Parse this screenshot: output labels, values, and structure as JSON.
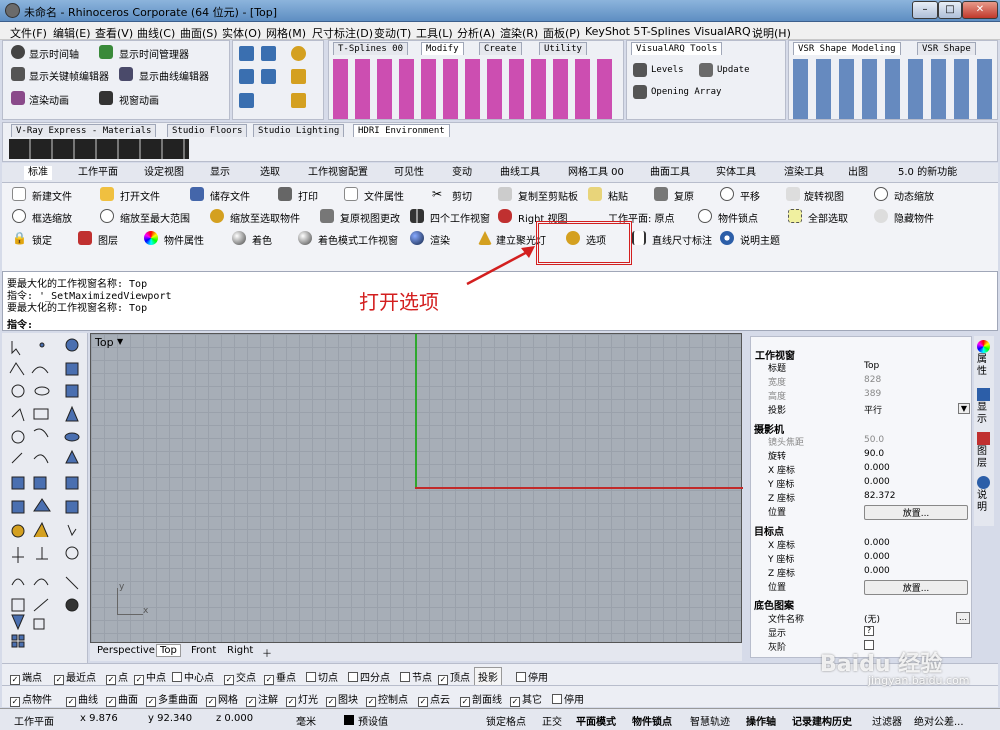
{
  "window": {
    "title": "未命名 - Rhinoceros Corporate (64 位元) - [Top]"
  },
  "menu": [
    "文件(F)",
    "编辑(E)",
    "查看(V)",
    "曲线(C)",
    "曲面(S)",
    "实体(O)",
    "网格(M)",
    "尺寸标注(D)",
    "变动(T)",
    "工具(L)",
    "分析(A)",
    "渲染(R)",
    "面板(P)",
    "KeyShot 5",
    "T-Splines",
    "VisualARQ",
    "说明(H)"
  ],
  "anim": {
    "items": [
      "显示时间轴",
      "显示时间管理器",
      "显示关键帧编辑器",
      "显示曲线编辑器",
      "渲染动画",
      "视窗动画"
    ]
  },
  "plugin_tabs1": [
    "T-Splines 00",
    "Modify",
    "Create",
    "Utility"
  ],
  "varq": {
    "tab": "VisualARQ Tools",
    "levels": "Levels",
    "update": "Update",
    "opening": "Opening Array"
  },
  "vsr": {
    "tab1": "VSR Shape Modeling",
    "tab2": "VSR Shape"
  },
  "mat_tabs": [
    "V-Ray Express - Materials",
    "Studio Floors",
    "Studio Lighting",
    "HDRI Environment"
  ],
  "std_tabs": [
    "标准",
    "工作平面",
    "设定视图",
    "显示",
    "选取",
    "工作视窗配置",
    "可见性",
    "变动",
    "曲线工具",
    "网格工具 00",
    "曲面工具",
    "实体工具",
    "渲染工具",
    "出图",
    "5.0 的新功能"
  ],
  "cmds": {
    "row1": [
      "新建文件",
      "打开文件",
      "储存文件",
      "打印",
      "文件属性",
      "剪切",
      "复制至剪贴板",
      "粘贴",
      "复原",
      "平移",
      "旋转视图",
      "动态缩放"
    ],
    "row2": [
      "框选缩放",
      "缩放至最大范围",
      "缩放至选取物件",
      "复原视图更改",
      "四个工作视窗",
      "Right 视图",
      "工作平面: 原点",
      "物件锁点",
      "全部选取",
      "隐藏物件"
    ],
    "row3": [
      "锁定",
      "图层",
      "物件属性",
      "着色",
      "着色模式工作视窗",
      "渲染",
      "建立聚光灯",
      "选项",
      "直线尺寸标注",
      "说明主题"
    ]
  },
  "history": [
    "要最大化的工作视窗名称: Top",
    "指令: '_SetMaximizedViewport",
    "要最大化的工作视窗名称: Top"
  ],
  "prompt": "指令:",
  "annotation": "打开选项",
  "viewport": {
    "name": "Top",
    "tabs": [
      "Perspective",
      "Top",
      "Front",
      "Right"
    ],
    "axis_x": "x",
    "axis_y": "y"
  },
  "props": {
    "title": "工作视窗",
    "rows1": [
      [
        "标题",
        "Top"
      ],
      [
        "宽度",
        "828"
      ],
      [
        "高度",
        "389"
      ],
      [
        "投影",
        "平行"
      ]
    ],
    "cam_title": "摄影机",
    "rows2": [
      [
        "镜头焦距",
        "50.0"
      ],
      [
        "旋转",
        "90.0"
      ],
      [
        "X 座标",
        "0.000"
      ],
      [
        "Y 座标",
        "0.000"
      ],
      [
        "Z 座标",
        "82.372"
      ],
      [
        "位置",
        "放置..."
      ]
    ],
    "tgt_title": "目标点",
    "rows3": [
      [
        "X 座标",
        "0.000"
      ],
      [
        "Y 座标",
        "0.000"
      ],
      [
        "Z 座标",
        "0.000"
      ],
      [
        "位置",
        "放置..."
      ]
    ],
    "bg_title": "底色图案",
    "rows4": [
      [
        "文件名称",
        "(无)"
      ],
      [
        "显示",
        ""
      ],
      [
        "灰阶",
        ""
      ]
    ],
    "side_tabs": [
      "属性",
      "显示",
      "图层",
      "说明"
    ]
  },
  "osnap": [
    "端点",
    "最近点",
    "点",
    "中点",
    "中心点",
    "交点",
    "垂点",
    "切点",
    "四分点",
    "节点",
    "顶点",
    "投影",
    "停用"
  ],
  "osnap_checked": [
    true,
    true,
    true,
    true,
    false,
    true,
    true,
    false,
    false,
    false,
    true,
    false,
    false
  ],
  "filter": [
    "点物件",
    "曲线",
    "曲面",
    "多重曲面",
    "网格",
    "注解",
    "灯光",
    "图块",
    "控制点",
    "点云",
    "剖面线",
    "其它",
    "停用"
  ],
  "status": {
    "plane": "工作平面",
    "x": "x 9.876",
    "y": "y 92.340",
    "z": "z 0.000",
    "unit": "毫米",
    "layer": "预设值",
    "items": [
      "锁定格点",
      "正交",
      "平面模式",
      "物件锁点",
      "智慧轨迹",
      "操作轴",
      "记录建构历史",
      "过滤器",
      "绝对公差..."
    ]
  },
  "watermark": "Baidu 经验",
  "watermark_url": "jingyan.baidu.com"
}
